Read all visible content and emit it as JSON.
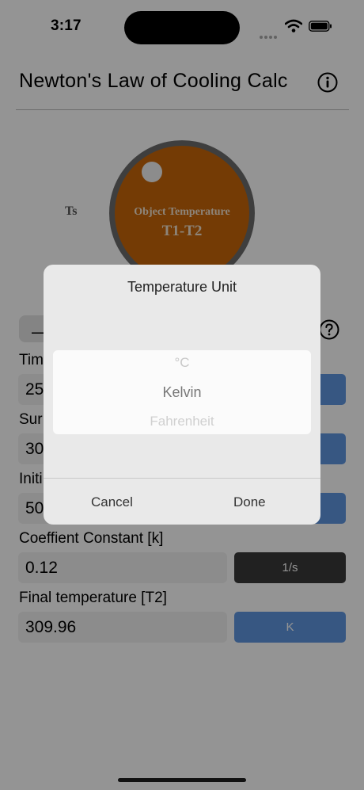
{
  "status_bar": {
    "time": "3:17"
  },
  "header": {
    "title": "Newton's Law of Cooling Calc",
    "info_icon": "info-icon"
  },
  "diagram": {
    "surroundings_label": "Ts",
    "object_title": "Object Temperature",
    "object_subtitle": "T1-T2",
    "object_color": "#c8670a"
  },
  "form": {
    "collapse_symbol": "—",
    "help_icon": "question-circle-icon",
    "fields": [
      {
        "label": "Tim",
        "value": "25",
        "unit": ""
      },
      {
        "label": "Sur",
        "value": "30",
        "unit": ""
      },
      {
        "label": "Initi",
        "value": "50",
        "unit": ""
      },
      {
        "label": "Coeffient Constant [k]",
        "value": "0.12",
        "unit": "1/s"
      },
      {
        "label": "Final temperature [T2]",
        "value": "309.96",
        "unit": "K"
      }
    ]
  },
  "dialog": {
    "title": "Temperature Unit",
    "options": [
      "°C",
      "Kelvin",
      "Fahrenheit"
    ],
    "selected": "Kelvin",
    "cancel_label": "Cancel",
    "done_label": "Done"
  }
}
